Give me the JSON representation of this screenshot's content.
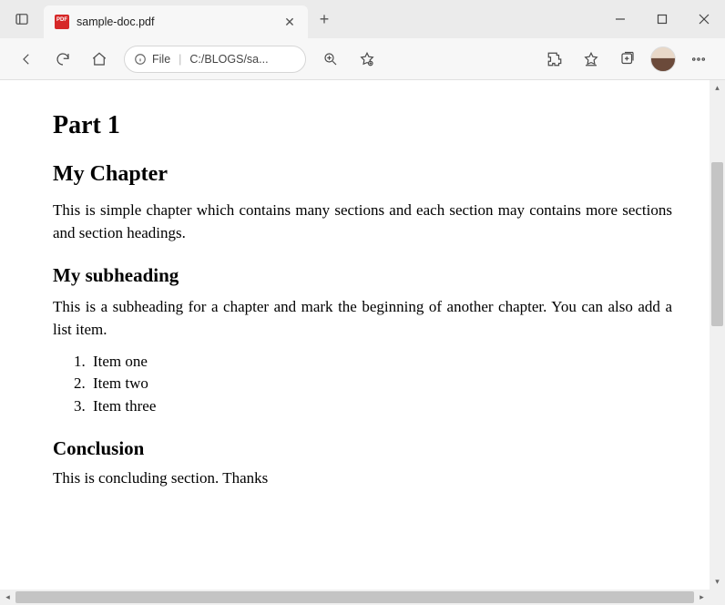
{
  "tab": {
    "title": "sample-doc.pdf"
  },
  "address": {
    "protocol": "File",
    "path": "C:/BLOGS/sa..."
  },
  "document": {
    "part": "Part 1",
    "chapter": "My Chapter",
    "chapter_body": "This is simple chapter which contains many sections and each section may contains more sections and section headings.",
    "subheading": "My subheading",
    "subheading_body": "This is a subheading for a chapter and mark the beginning of another chapter. You can also add a list item.",
    "items": [
      "Item one",
      "Item two",
      "Item three"
    ],
    "conclusion_heading": "Conclusion",
    "conclusion_body": "This is concluding section.  Thanks"
  }
}
